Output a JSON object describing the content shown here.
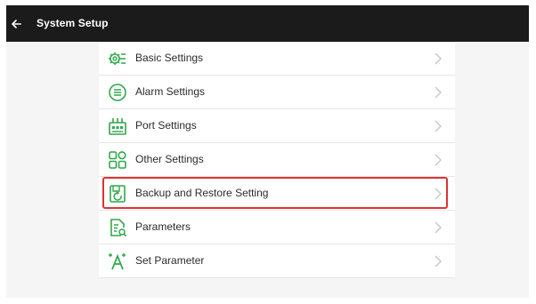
{
  "header": {
    "back_icon": "arrow-left-icon",
    "title": "System Setup"
  },
  "colors": {
    "header_bg": "#1b1b1b",
    "accent_green": "#2ea84a",
    "highlight_red": "#e03131"
  },
  "menu": {
    "items": [
      {
        "label": "Basic Settings",
        "icon": "gear-settings-icon"
      },
      {
        "label": "Alarm Settings",
        "icon": "alarm-list-icon"
      },
      {
        "label": "Port Settings",
        "icon": "port-icon"
      },
      {
        "label": "Other Settings",
        "icon": "grid-apps-icon"
      },
      {
        "label": "Backup and Restore Setting",
        "icon": "backup-restore-icon",
        "highlighted": true
      },
      {
        "label": "Parameters",
        "icon": "document-parameters-icon"
      },
      {
        "label": "Set Parameter",
        "icon": "magic-wand-icon"
      }
    ]
  }
}
